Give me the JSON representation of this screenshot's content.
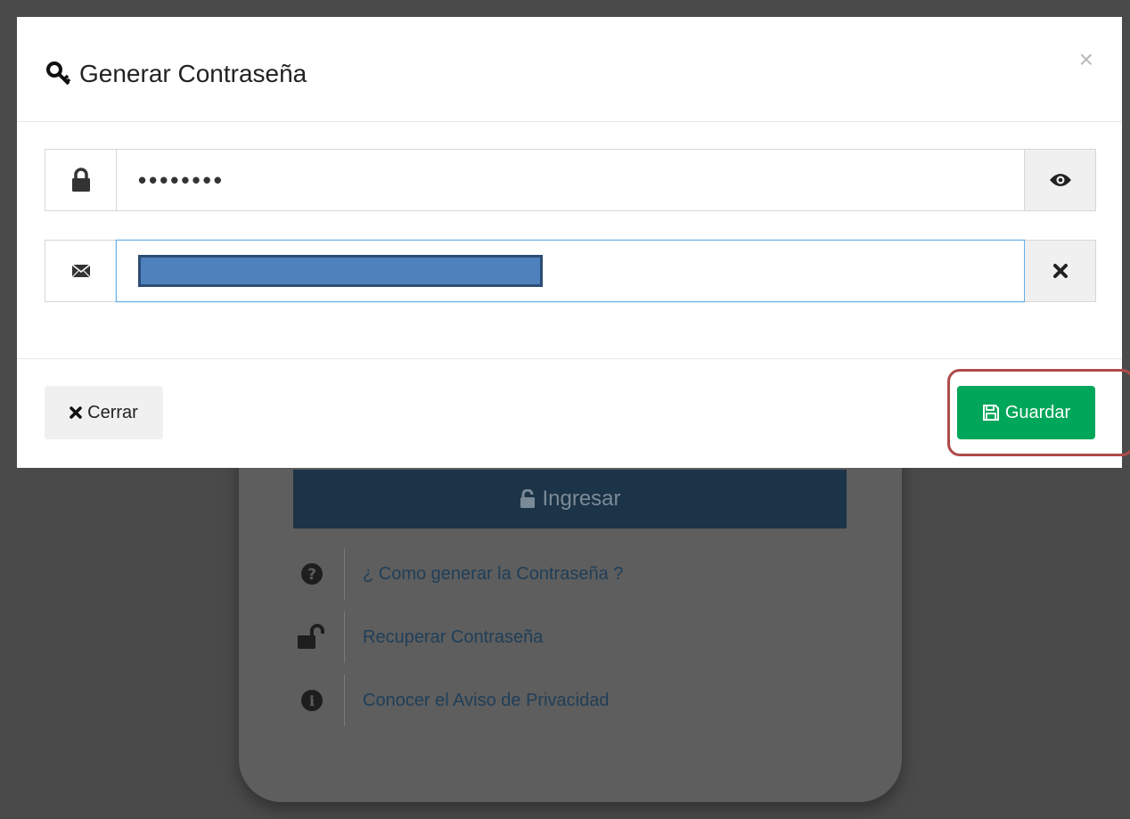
{
  "modal": {
    "title": "Generar Contraseña",
    "title_icon": "key-icon",
    "close_symbol": "×",
    "password_field": {
      "masked_value": "••••••••",
      "left_icon": "lock-icon",
      "right_icon": "eye-icon"
    },
    "email_field": {
      "left_icon": "envelope-icon",
      "right_icon": "times-icon",
      "redacted": true
    },
    "cerrar_label": "Cerrar",
    "guardar_label": "Guardar",
    "guardar_color": "#00a65a",
    "highlight_color": "#b04a4a"
  },
  "background": {
    "ingresar_label": "Ingresar",
    "links": [
      {
        "label": "¿ Como generar la Contraseña ?",
        "icon": "question-circle-icon"
      },
      {
        "label": "Recuperar Contraseña",
        "icon": "unlock-icon"
      },
      {
        "label": "Conocer el Aviso de Privacidad",
        "icon": "info-circle-icon"
      }
    ]
  }
}
